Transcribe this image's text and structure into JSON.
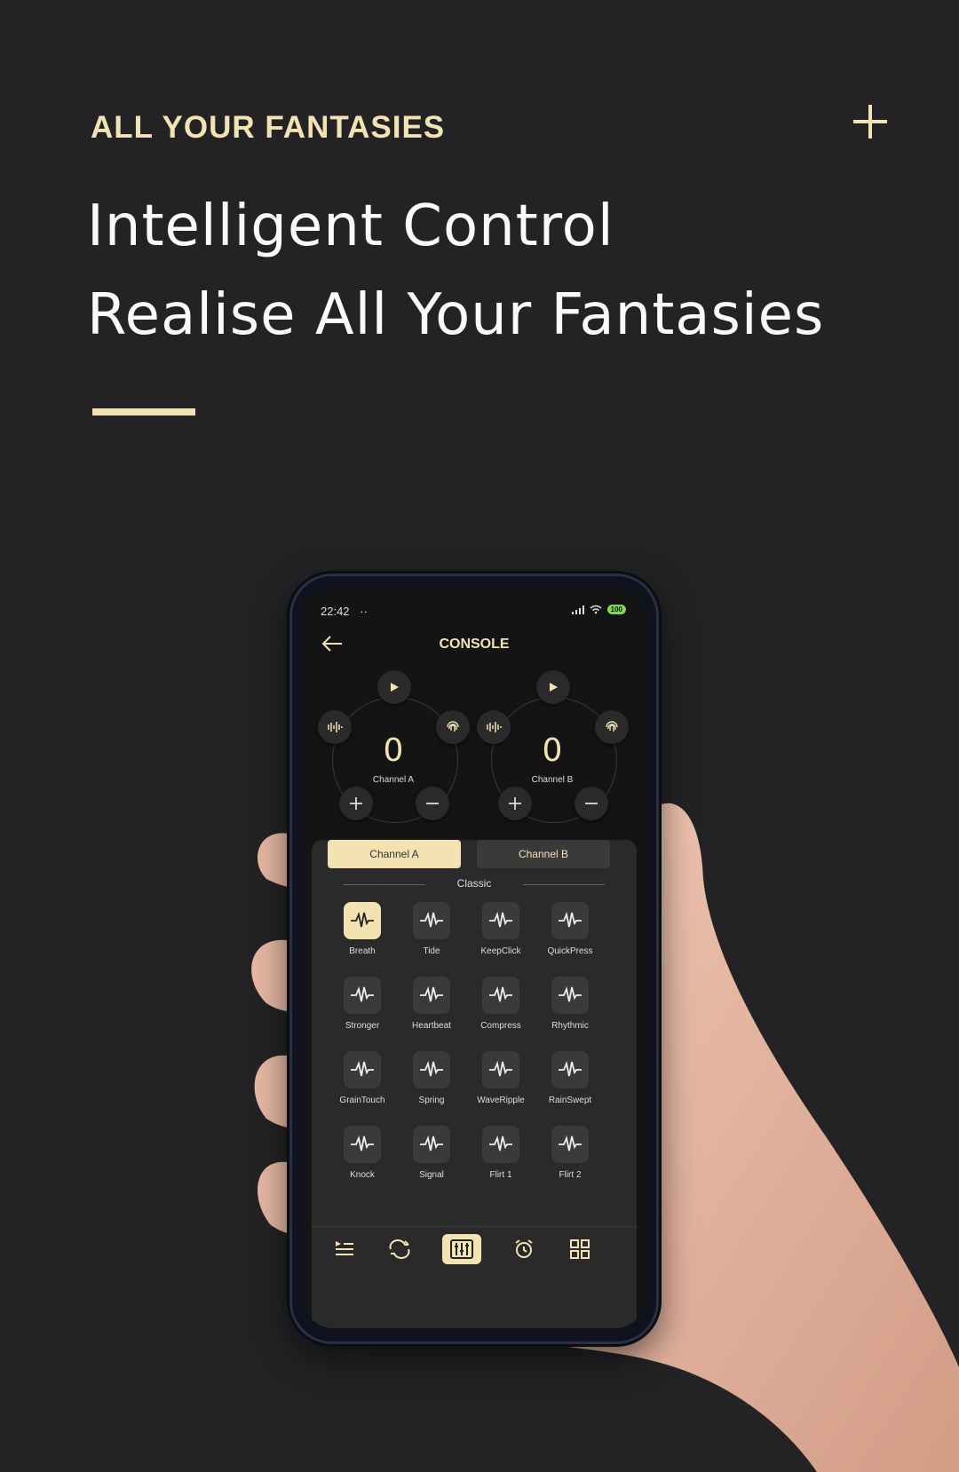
{
  "header": {
    "eyebrow": "ALL YOUR FANTASIES",
    "headline_line1": "Intelligent Control",
    "headline_line2": "Realise All Your Fantasies",
    "plus_icon": "plus-icon",
    "accent": "#f3e2b2"
  },
  "phone": {
    "status": {
      "time": "22:42",
      "dots": "··",
      "battery": "100"
    },
    "title": "CONSOLE",
    "channels": [
      {
        "value": "0",
        "label": "Channel A"
      },
      {
        "value": "0",
        "label": "Channel B"
      }
    ],
    "tabs": {
      "a": "Channel A",
      "b": "Channel B"
    },
    "section": "Classic",
    "modes": [
      "Breath",
      "Tide",
      "KeepClick",
      "QuickPress",
      "Stronger",
      "Heartbeat",
      "Compress",
      "Rhythmic",
      "GrainTouch",
      "Spring",
      "WaveRipple",
      "RainSwept",
      "Knock",
      "Signal",
      "Flirt 1",
      "Flirt 2"
    ],
    "active_mode": "Breath",
    "nav": [
      "list-play-icon",
      "repeat-icon",
      "mixer-icon",
      "alarm-icon",
      "grid-icon"
    ],
    "active_nav": "mixer-icon"
  }
}
